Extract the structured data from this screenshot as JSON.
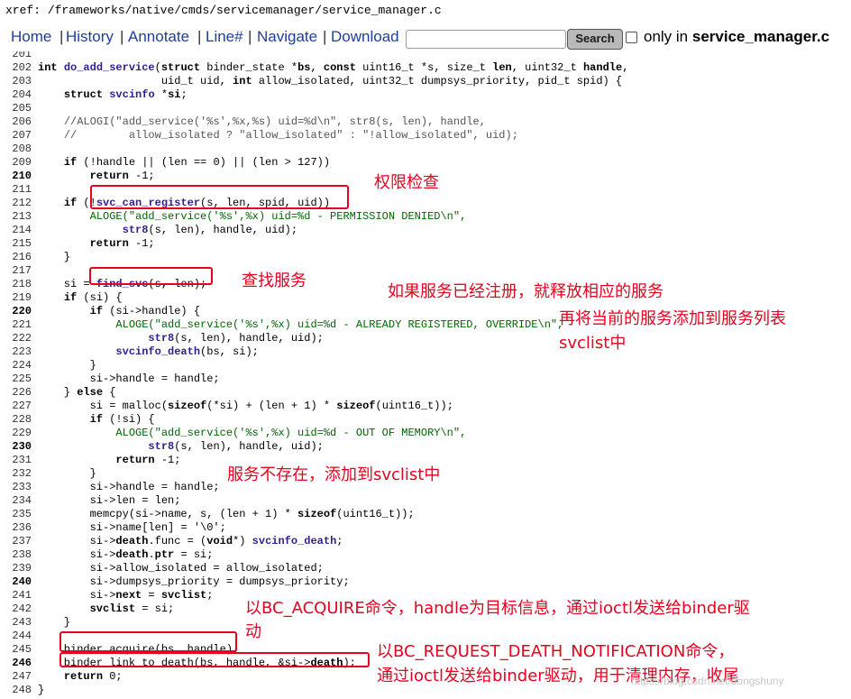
{
  "xref": {
    "label": "xref:",
    "path": "/frameworks/native/cmds/servicemanager/service_manager.c"
  },
  "nav": {
    "items": [
      "Home",
      "History",
      "Annotate",
      "Line#",
      "Navigate",
      "Download"
    ],
    "separator": "|",
    "search_button": "Search",
    "only_in_prefix": "only in",
    "only_in_file": "service_manager.c",
    "search_value": ""
  },
  "code": {
    "lines": [
      {
        "n": "201",
        "t": ""
      },
      {
        "n": "202",
        "t": ""
      },
      {
        "n": "203",
        "t": ""
      },
      {
        "n": "204",
        "t": ""
      },
      {
        "n": "205",
        "t": ""
      },
      {
        "n": "206",
        "t": ""
      },
      {
        "n": "207",
        "t": ""
      },
      {
        "n": "208",
        "t": ""
      },
      {
        "n": "209",
        "t": ""
      },
      {
        "n": "210",
        "t": ""
      },
      {
        "n": "211",
        "t": ""
      },
      {
        "n": "212",
        "t": ""
      },
      {
        "n": "213",
        "t": ""
      },
      {
        "n": "214",
        "t": ""
      },
      {
        "n": "215",
        "t": ""
      },
      {
        "n": "216",
        "t": ""
      },
      {
        "n": "217",
        "t": ""
      },
      {
        "n": "218",
        "t": ""
      },
      {
        "n": "219",
        "t": ""
      },
      {
        "n": "220",
        "t": ""
      },
      {
        "n": "221",
        "t": ""
      },
      {
        "n": "222",
        "t": ""
      },
      {
        "n": "223",
        "t": ""
      },
      {
        "n": "224",
        "t": ""
      },
      {
        "n": "225",
        "t": ""
      },
      {
        "n": "226",
        "t": ""
      },
      {
        "n": "227",
        "t": ""
      },
      {
        "n": "228",
        "t": ""
      },
      {
        "n": "229",
        "t": ""
      },
      {
        "n": "230",
        "t": ""
      },
      {
        "n": "231",
        "t": ""
      },
      {
        "n": "232",
        "t": ""
      },
      {
        "n": "233",
        "t": ""
      },
      {
        "n": "234",
        "t": ""
      },
      {
        "n": "235",
        "t": ""
      },
      {
        "n": "236",
        "t": ""
      },
      {
        "n": "237",
        "t": ""
      },
      {
        "n": "238",
        "t": ""
      },
      {
        "n": "239",
        "t": ""
      },
      {
        "n": "240",
        "t": ""
      },
      {
        "n": "241",
        "t": ""
      },
      {
        "n": "242",
        "t": ""
      },
      {
        "n": "243",
        "t": ""
      },
      {
        "n": "244",
        "t": ""
      },
      {
        "n": "245",
        "t": ""
      },
      {
        "n": "246",
        "t": ""
      },
      {
        "n": "247",
        "t": ""
      },
      {
        "n": "248",
        "t": ""
      }
    ],
    "text": [
      "",
      "<span class=\"kw\">int</span> <span class=\"fn\">do_add_service</span>(<span class=\"kw\">struct</span> binder_state *<span class=\"kw\">bs</span>, <span class=\"kw\">const</span> uint16_t *s, size_t <span class=\"kw\">len</span>, uint32_t <span class=\"kw\">handle</span>,",
      "                   uid_t uid, <span class=\"kw\">int</span> allow_isolated, uint32_t dumpsys_priority, pid_t spid) {",
      "    <span class=\"kw\">struct</span> <span class=\"fn\">svcinfo</span> *<span class=\"kw\">si</span>;",
      "",
      "    <span class=\"cm\">//ALOGI(\"add_service('%s',%x,%s) uid=%d\\n\", str8(s, len), handle,</span>",
      "    <span class=\"cm\">//        allow_isolated ? \"allow_isolated\" : \"!allow_isolated\", uid);</span>",
      "",
      "    <span class=\"kw\">if</span> (!handle || (len == 0) || (len > 127))",
      "        <span class=\"kw\">return</span> -1;",
      "",
      "    <span class=\"kw\">if</span> (!<span class=\"fn\">svc_can_register</span>(s, len, spid, uid))",
      "        <span class=\"st\">ALOGE(\"add_service('%s',%x) uid=%d - PERMISSION DENIED\\n\",</span>",
      "             <span class=\"fn\">str8</span>(s, len), handle, uid);",
      "        <span class=\"kw\">return</span> -1;",
      "    }",
      "",
      "    si = <span class=\"fn\">find_svc</span>(s, len);",
      "    <span class=\"kw\">if</span> (si) {",
      "        <span class=\"kw\">if</span> (si->handle) {",
      "            <span class=\"st\">ALOGE(\"add_service('%s',%x) uid=%d - ALREADY REGISTERED, OVERRIDE\\n\",</span>",
      "                 <span class=\"fn\">str8</span>(s, len), handle, uid);",
      "            <span class=\"fn\">svcinfo_death</span>(bs, si);",
      "        }",
      "        si->handle = handle;",
      "    } <span class=\"kw\">else</span> {",
      "        si = malloc(<span class=\"kw\">sizeof</span>(*si) + (len + 1) * <span class=\"kw\">sizeof</span>(uint16_t));",
      "        <span class=\"kw\">if</span> (!si) {",
      "            <span class=\"st\">ALOGE(\"add_service('%s',%x) uid=%d - OUT OF MEMORY\\n\",</span>",
      "                 <span class=\"fn\">str8</span>(s, len), handle, uid);",
      "            <span class=\"kw\">return</span> -1;",
      "        }",
      "        si->handle = handle;",
      "        si->len = len;",
      "        memcpy(si->name, s, (len + 1) * <span class=\"kw\">sizeof</span>(uint16_t));",
      "        si->name[len] = '\\0';",
      "        si-><span class=\"kw\">death</span>.func = (<span class=\"kw\">void</span>*) <span class=\"fn\">svcinfo_death</span>;",
      "        si-><span class=\"kw\">death</span>.<span class=\"kw\">ptr</span> = si;",
      "        si->allow_isolated = allow_isolated;",
      "        si->dumpsys_priority = dumpsys_priority;",
      "        si-><span class=\"kw\">next</span> = <span class=\"kw\">svclist</span>;",
      "        <span class=\"kw\">svclist</span> = si;",
      "    }",
      "",
      "    binder_acquire(bs, handle);",
      "    binder_link_to_death(bs, handle, &si-><span class=\"kw\">death</span>);",
      "    <span class=\"kw\">return</span> 0;",
      "}"
    ]
  },
  "annotations": [
    "权限检查",
    "查找服务",
    "如果服务已经注册，就释放相应的服务",
    "再将当前的服务添加到服务列表",
    "svclist中",
    "服务不存在，添加到svclist中",
    "以BC_ACQUIRE命令，handle为目标信息，通过ioctl发送给binder驱",
    "动",
    "以BC_REQUEST_DEATH_NOTIFICATION命令，",
    "通过ioctl发送给binder驱动，用于清理内存，收尾"
  ],
  "watermark": "https://blog.csdn.net/dongshuny",
  "colors": {
    "link": "#1f3e9c",
    "annotation": "#e8001e",
    "function": "#2f1f8f"
  }
}
